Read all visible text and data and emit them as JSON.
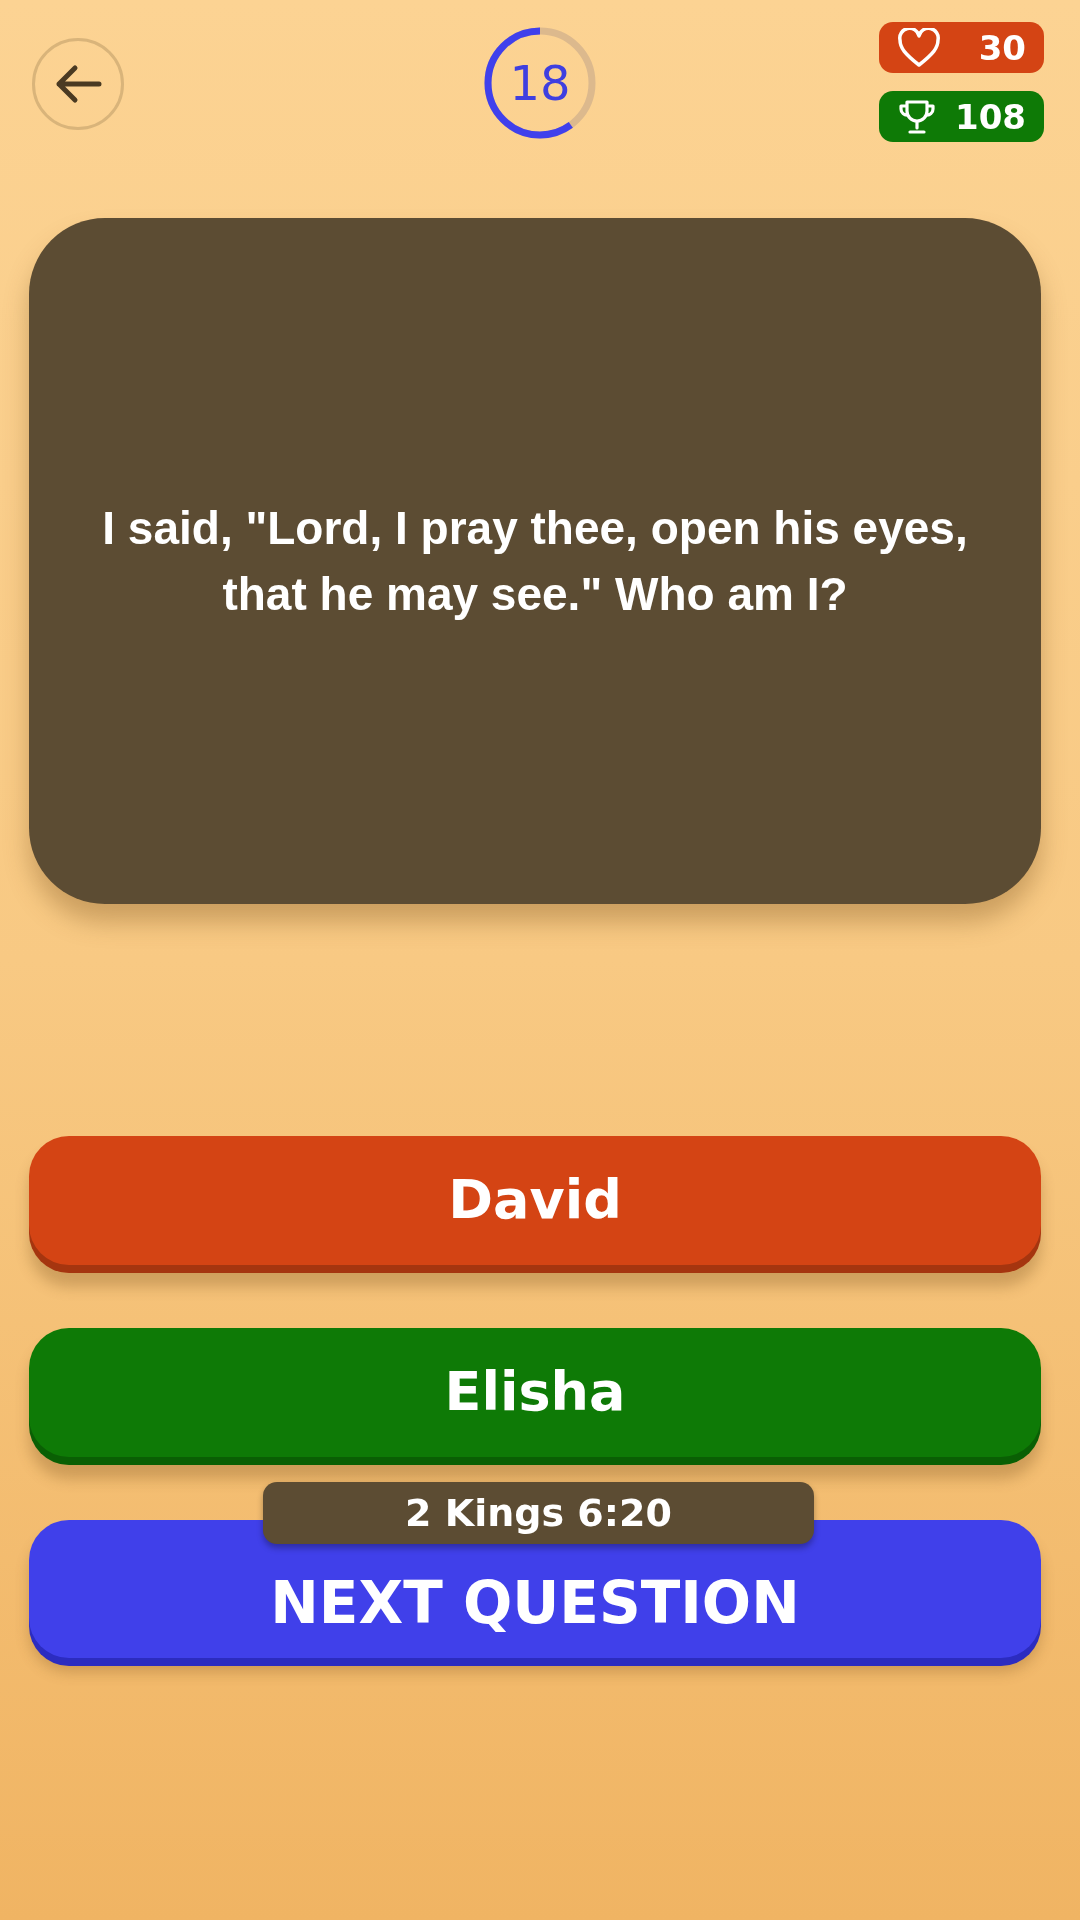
{
  "header": {
    "timer": {
      "value": "18",
      "level": 0.6
    },
    "lives": "30",
    "score": "108"
  },
  "question": "I said, \"Lord, I pray thee, open his eyes, that he may see.\" Who am I?",
  "answers": [
    {
      "label": "David",
      "color": "#d44414"
    },
    {
      "label": "Elisha",
      "color": "#0e7a06"
    }
  ],
  "reference": "2 Kings 6:20",
  "next_button": "NEXT QUESTION"
}
